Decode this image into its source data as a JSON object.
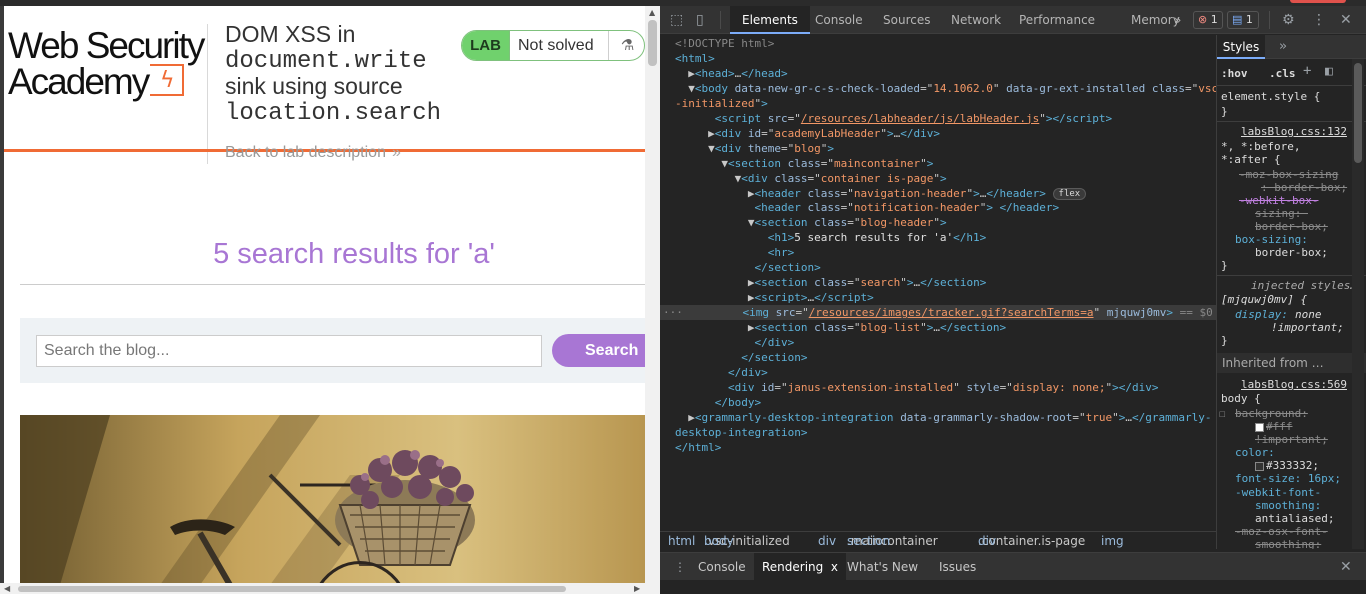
{
  "page": {
    "logo_line1": "Web Security",
    "logo_line2": "Academy",
    "logo_mark": "ϟ",
    "lab_title_prefix": "DOM XSS in",
    "lab_title_code1": "document.write",
    "lab_title_mid": "sink using source",
    "lab_title_code2": "location.search",
    "badge_label": "LAB",
    "status_label": "Not solved",
    "back_link": "Back to lab description",
    "results_heading": "5 search results for 'a'",
    "search_placeholder": "Search the blog...",
    "search_button": "Search",
    "colors": {
      "accent_orange": "#f06b35",
      "purple": "#a876d4",
      "lab_green": "#70d16d"
    }
  },
  "devtools": {
    "tabs": [
      "Elements",
      "Console",
      "Sources",
      "Network",
      "Performance",
      "Memory"
    ],
    "more_tabs": "»",
    "error_count": "1",
    "message_count": "1",
    "elements_lines": [
      {
        "html": "<span class=\"cm\">&lt;!DOCTYPE html&gt;</span>"
      },
      {
        "html": "<span class=\"t\">&lt;html&gt;</span>"
      },
      {
        "html": "  ▶<span class=\"t\">&lt;head&gt;</span>…<span class=\"t\">&lt;/head&gt;</span>"
      },
      {
        "html": "  ▼<span class=\"t\">&lt;body </span><span class=\"a\">data-new-gr-c-s-check-loaded</span>=\"<span class=\"v\">14.1062.0</span>\" <span class=\"a\">data-gr-ext-installed</span> <span class=\"a\">class</span>=\"<span class=\"v\">vsc</span>"
      },
      {
        "html": "<span class=\"v\">-initialized</span>\"<span class=\"t\">&gt;</span>"
      },
      {
        "html": "      <span class=\"t\">&lt;script </span><span class=\"a\">src</span>=\"<span class=\"u\">/resources/labheader/js/labHeader.js</span>\"<span class=\"t\">&gt;&lt;/script&gt;</span>"
      },
      {
        "html": "     ▶<span class=\"t\">&lt;div </span><span class=\"a\">id</span>=\"<span class=\"v\">academyLabHeader</span>\"<span class=\"t\">&gt;</span>…<span class=\"t\">&lt;/div&gt;</span>"
      },
      {
        "html": "     ▼<span class=\"t\">&lt;div </span><span class=\"a\">theme</span>=\"<span class=\"v\">blog</span>\"<span class=\"t\">&gt;</span>"
      },
      {
        "html": "       ▼<span class=\"t\">&lt;section </span><span class=\"a\">class</span>=\"<span class=\"v\">maincontainer</span>\"<span class=\"t\">&gt;</span>"
      },
      {
        "html": "         ▼<span class=\"t\">&lt;div </span><span class=\"a\">class</span>=\"<span class=\"v\">container is-page</span>\"<span class=\"t\">&gt;</span>"
      },
      {
        "html": "           ▶<span class=\"t\">&lt;header </span><span class=\"a\">class</span>=\"<span class=\"v\">navigation-header</span>\"<span class=\"t\">&gt;</span>…<span class=\"t\">&lt;/header&gt;</span> <span class=\"flexb\">flex</span>"
      },
      {
        "html": "            <span class=\"t\">&lt;header </span><span class=\"a\">class</span>=\"<span class=\"v\">notification-header</span>\"<span class=\"t\">&gt; &lt;/header&gt;</span>"
      },
      {
        "html": "           ▼<span class=\"t\">&lt;section </span><span class=\"a\">class</span>=\"<span class=\"v\">blog-header</span>\"<span class=\"t\">&gt;</span>"
      },
      {
        "html": "              <span class=\"t\">&lt;h1&gt;</span><span class=\"tx\">5 search results for 'a'</span><span class=\"t\">&lt;/h1&gt;</span>"
      },
      {
        "html": "              <span class=\"t\">&lt;hr&gt;</span>"
      },
      {
        "html": "            <span class=\"t\">&lt;/section&gt;</span>"
      },
      {
        "html": "           ▶<span class=\"t\">&lt;section </span><span class=\"a\">class</span>=\"<span class=\"v\">search</span>\"<span class=\"t\">&gt;</span>…<span class=\"t\">&lt;/section&gt;</span>"
      },
      {
        "html": "           ▶<span class=\"t\">&lt;script&gt;</span>…<span class=\"t\">&lt;/script&gt;</span>"
      },
      {
        "html": "<span class=\"cm\">···</span>         <span class=\"t\">&lt;img </span><span class=\"a\">src</span>=\"<span class=\"u\">/resources/images/tracker.gif?searchTerms=a</span>\" <span class=\"a\">mjquwj0mv</span><span class=\"t\">&gt;</span> <span class=\"dolar\">== $0</span>",
        "selected": true
      },
      {
        "html": "           ▶<span class=\"t\">&lt;section </span><span class=\"a\">class</span>=\"<span class=\"v\">blog-list</span>\"<span class=\"t\">&gt;</span>…<span class=\"t\">&lt;/section&gt;</span>"
      },
      {
        "html": "            <span class=\"t\">&lt;/div&gt;</span>"
      },
      {
        "html": "          <span class=\"t\">&lt;/section&gt;</span>"
      },
      {
        "html": "        <span class=\"t\">&lt;/div&gt;</span>"
      },
      {
        "html": "        <span class=\"t\">&lt;div </span><span class=\"a\">id</span>=\"<span class=\"v\">janus-extension-installed</span>\" <span class=\"a\">style</span>=\"<span class=\"v\">display: none;</span>\"<span class=\"t\">&gt;&lt;/div&gt;</span>"
      },
      {
        "html": "      <span class=\"t\">&lt;/body&gt;</span>"
      },
      {
        "html": "  ▶<span class=\"t\">&lt;grammarly-desktop-integration </span><span class=\"a\">data-grammarly-shadow-root</span>=\"<span class=\"v\">true</span>\"<span class=\"t\">&gt;</span>…<span class=\"t\">&lt;/grammarly-</span>"
      },
      {
        "html": "<span class=\"t\">desktop-integration&gt;</span>"
      },
      {
        "html": "<span class=\"t\">&lt;/html&gt;</span>"
      }
    ],
    "breadcrumbs": [
      {
        "tag": "html",
        "cls": ""
      },
      {
        "tag": "body",
        "cls": ".vsc-initialized"
      },
      {
        "tag": "div",
        "cls": ""
      },
      {
        "tag": "section",
        "cls": ".maincontainer"
      },
      {
        "tag": "div",
        "cls": ".container.is-page"
      },
      {
        "tag": "img",
        "cls": ""
      }
    ],
    "styles_tab": "Styles",
    "styles_more": "»",
    "hov": ":hov",
    "cls": ".cls",
    "element_style": "element.style {",
    "close_brace": "}",
    "labs_blog_1": "labsBlog.css:132",
    "universal_selector": "*, *:before,",
    "universal_selector2": "*:after {",
    "moz_box_sizing": "-moz-box-sizing",
    "moz_box_sizing_val": ": border-box;",
    "webkit_box": "-webkit-box-",
    "webkit_box2": "sizing: ",
    "webkit_box_val": "border-box;",
    "box_sizing": "box-sizing:",
    "box_sizing_val": "border-box;",
    "injected": "injected styles…",
    "injected_sel": "[mjquwj0mv] {",
    "display_prop": "display:",
    "display_val": "none",
    "important": "!important;",
    "inherited_from": "Inherited from …",
    "labs_blog_2": "labsBlog.css:569",
    "body_sel": "body {",
    "bg_prop": "background:",
    "bg_val": "#fff",
    "bg_imp": "!important;",
    "color_prop": "color:",
    "color_val": "#333332;",
    "font_size": "font-size: 16px;",
    "wk_font": "-webkit-font-",
    "wk_font2": "smoothing:",
    "wk_font_val": "antialiased;",
    "moz_osx": "-moz-osx-font-",
    "moz_osx2": "smoothing:",
    "drawer_tabs": [
      "Console",
      "Rendering",
      "What's New",
      "Issues"
    ],
    "drawer_close": "x"
  }
}
